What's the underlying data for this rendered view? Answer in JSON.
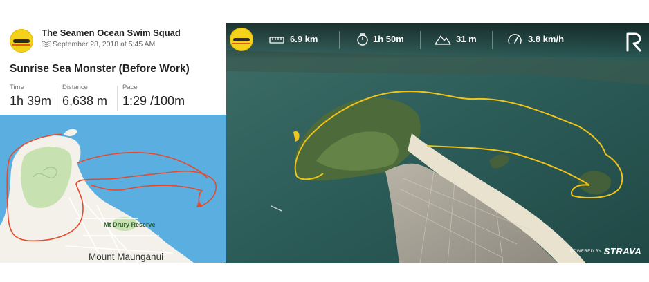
{
  "left_panel": {
    "club_name": "The Seamen Ocean Swim Squad",
    "activity_date": "September 28, 2018 at 5:45 AM",
    "activity_title": "Sunrise Sea Monster (Before Work)",
    "stats": [
      {
        "label": "Time",
        "value": "1h 39m"
      },
      {
        "label": "Distance",
        "value": "6,638 m"
      },
      {
        "label": "Pace",
        "value": "1:29 /100m"
      }
    ],
    "map": {
      "place_label": "Mt Drury Reserve",
      "town_label": "Mount Maunganui",
      "route_color": "#e8492b",
      "water_color": "#5aaee0",
      "land_color": "#f3f1ea",
      "park_color": "#c7e2b0"
    }
  },
  "right_panel": {
    "metrics": [
      {
        "icon": "ruler-icon",
        "value": "6.9 km"
      },
      {
        "icon": "stopwatch-icon",
        "value": "1h 50m"
      },
      {
        "icon": "mountain-icon",
        "value": "31 m"
      },
      {
        "icon": "speedometer-icon",
        "value": "3.8 km/h"
      }
    ],
    "brand_icon": "relive-logo",
    "powered_by": "POWERED BY",
    "strava": "STRAVA",
    "route_color": "#f0c419"
  }
}
